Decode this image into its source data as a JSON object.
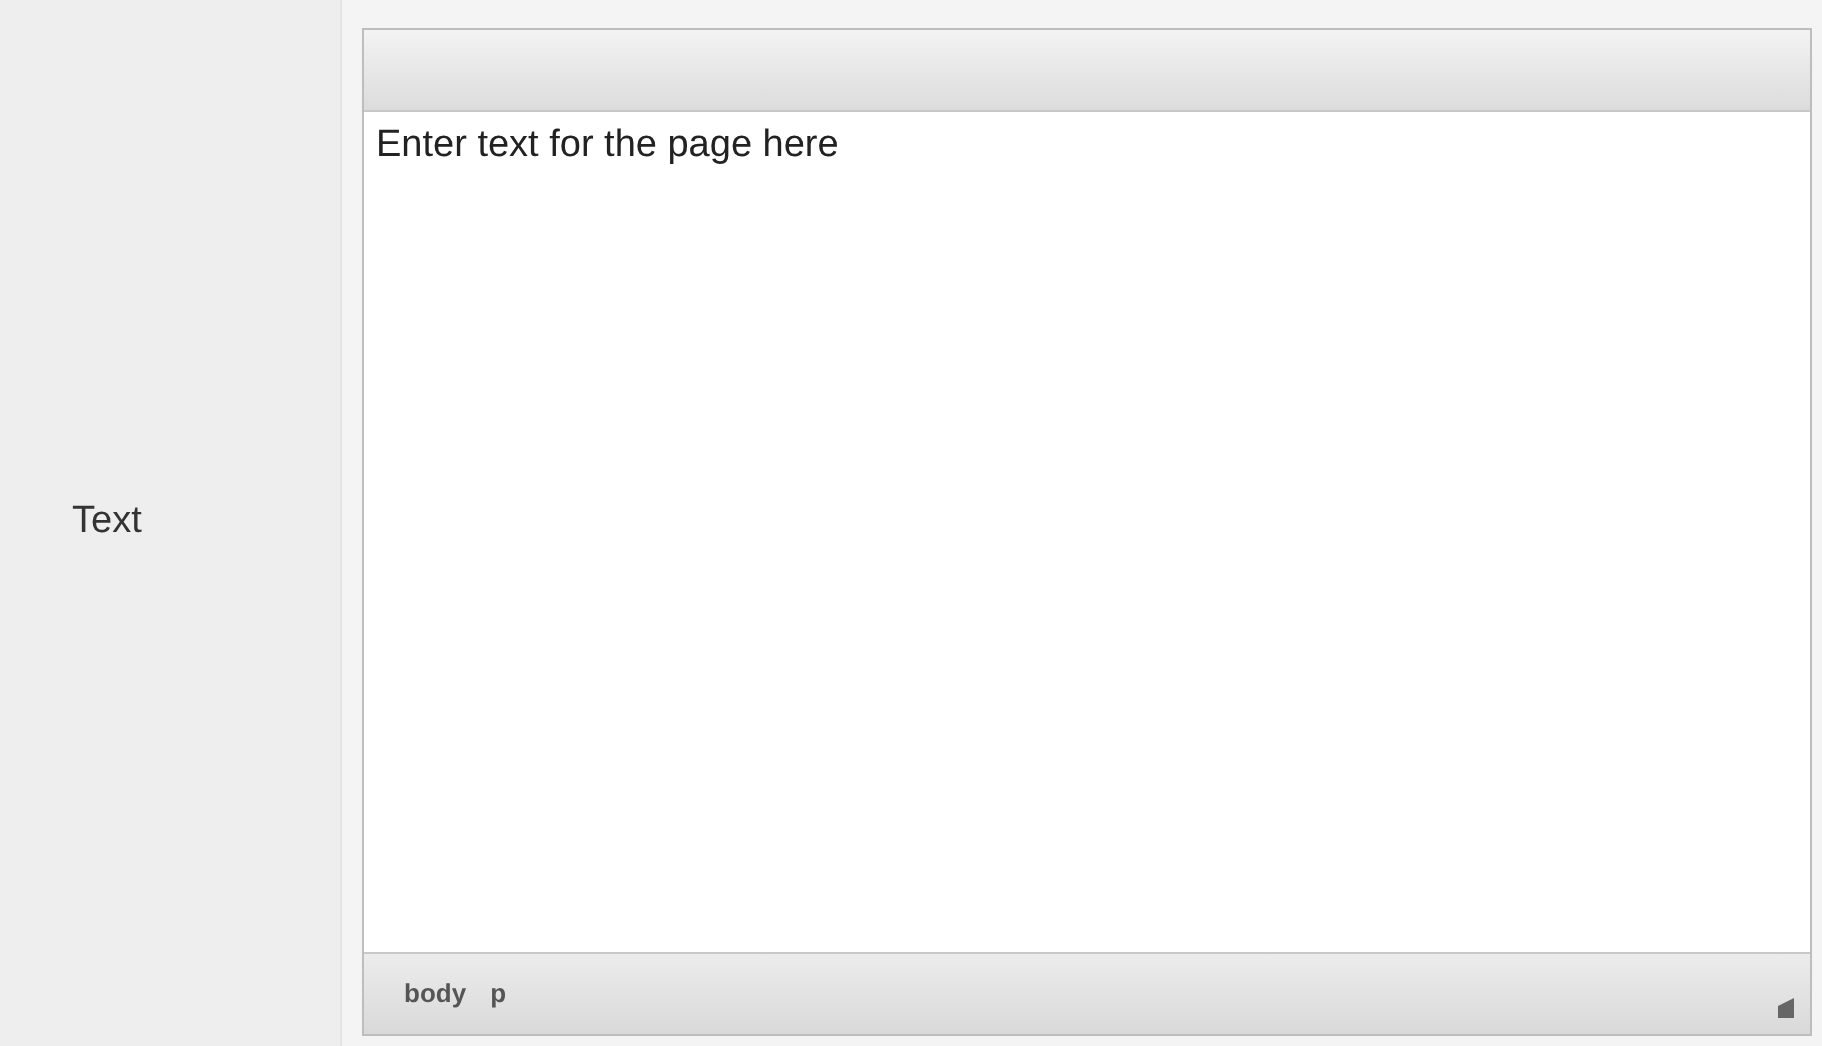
{
  "field": {
    "label": "Text"
  },
  "editor": {
    "content": "Enter text for the page here",
    "path": [
      "body",
      "p"
    ]
  }
}
